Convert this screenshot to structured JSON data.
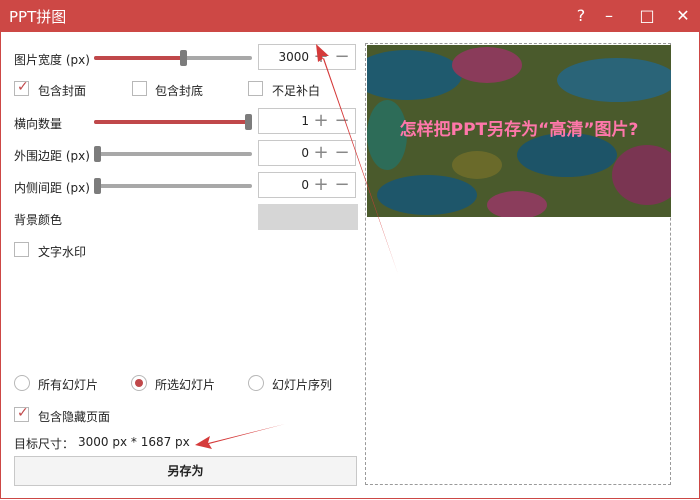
{
  "window": {
    "title": "PPT拼图",
    "help": "?",
    "minimize": "–",
    "maximize": "□",
    "close": "✕"
  },
  "controls": {
    "width": {
      "label": "图片宽度 (px)",
      "value": "3000",
      "slider_fraction": 0.57
    },
    "checks_row": [
      {
        "label": "包含封面",
        "checked": true
      },
      {
        "label": "包含封底",
        "checked": false
      },
      {
        "label": "不足补白",
        "checked": false
      }
    ],
    "horizontal_count": {
      "label": "横向数量",
      "value": "1",
      "slider_fraction": 1.0
    },
    "outer_margin": {
      "label": "外围边距 (px)",
      "value": "0",
      "slider_fraction": 0.0
    },
    "inner_spacing": {
      "label": "内侧间距 (px)",
      "value": "0",
      "slider_fraction": 0.0
    },
    "background_color": {
      "label": "背景颜色",
      "color": "#d6d6d6"
    },
    "watermark": {
      "label": "文字水印",
      "checked": false
    }
  },
  "slides": {
    "options": [
      {
        "label": "所有幻灯片",
        "selected": false
      },
      {
        "label": "所选幻灯片",
        "selected": true
      },
      {
        "label": "幻灯片序列",
        "selected": false
      }
    ],
    "include_hidden": {
      "label": "包含隐藏页面",
      "checked": true
    }
  },
  "target_size": {
    "label": "目标尺寸：",
    "text": "3000 px *  1687 px"
  },
  "save_button": "另存为",
  "preview": {
    "caption": "怎样把PPT另存为“高清”图片?"
  },
  "colors": {
    "accent": "#c0484a",
    "titlebar": "#cd4845"
  }
}
